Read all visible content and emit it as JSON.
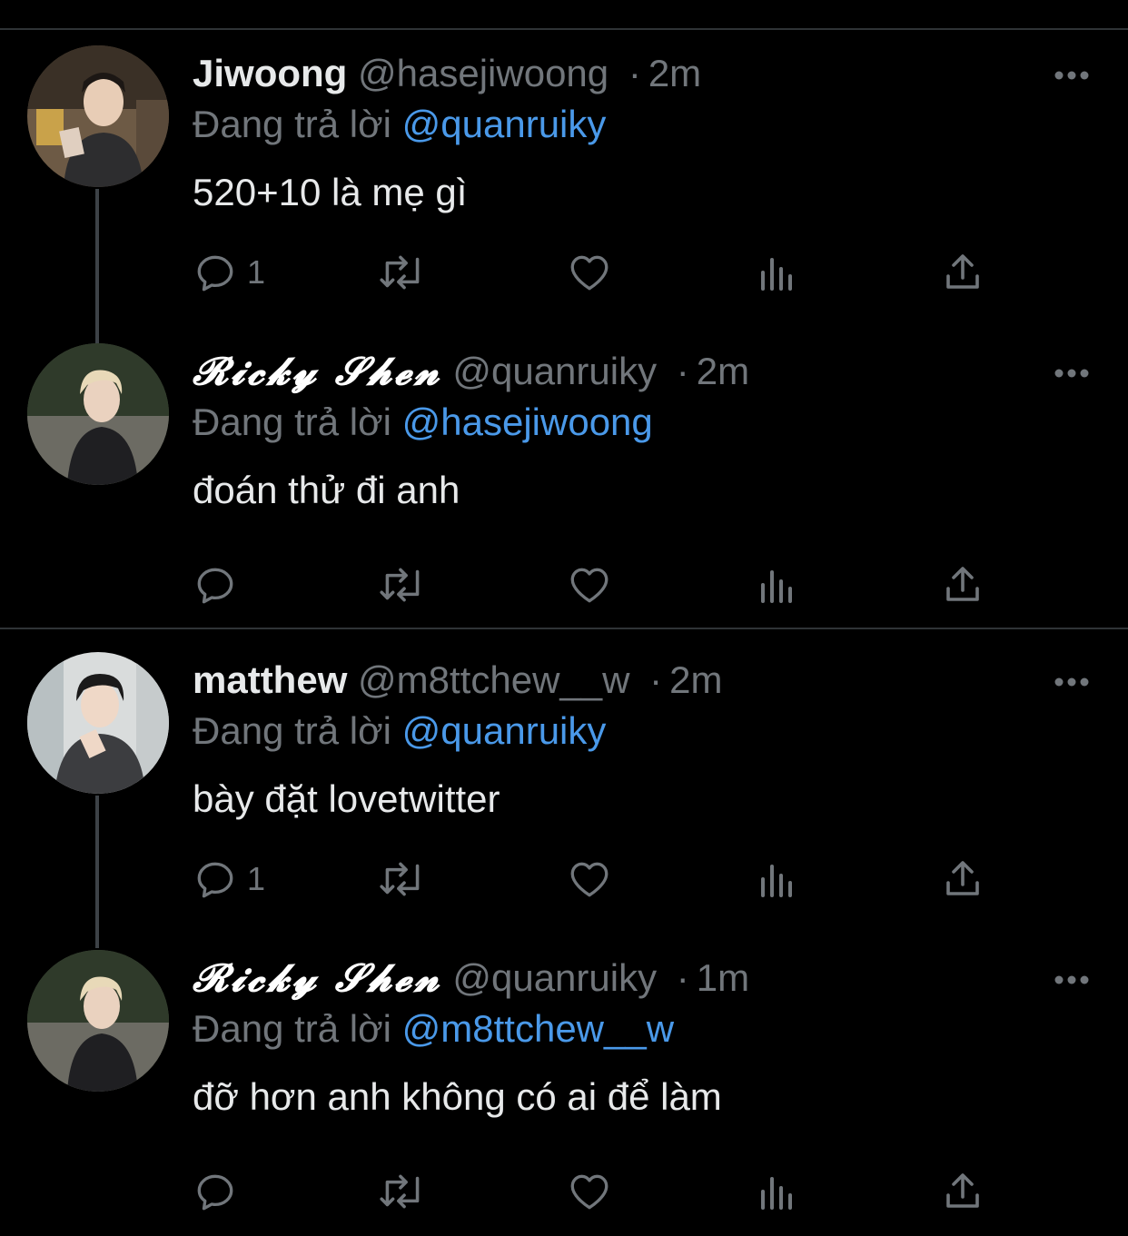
{
  "colors": {
    "background": "#000000",
    "text": "#e7e9ea",
    "muted": "#71767b",
    "link": "#4a99e9",
    "divider": "#2f3336",
    "thread_line": "#3d4247"
  },
  "reply_prefix": "Đang trả lời",
  "tweets": [
    {
      "name": "Jiwoong",
      "handle": "@hasejiwoong",
      "separator": "·",
      "time": "2m",
      "reply_to": "@quanruiky",
      "text": "520+10 là mẹ gì",
      "reply_count": "1",
      "avatar": "avatar-jiwoong"
    },
    {
      "name": "𝓡𝓲𝓬𝓴𝔂 𝓢𝓱𝓮𝓷",
      "handle": "@quanruiky",
      "separator": "·",
      "time": "2m",
      "reply_to": "@hasejiwoong",
      "text": "đoán thử đi anh",
      "reply_count": "",
      "avatar": "avatar-ricky"
    },
    {
      "name": "matthew",
      "handle": "@m8ttchew__w",
      "separator": "·",
      "time": "2m",
      "reply_to": "@quanruiky",
      "text": "bày đặt lovetwitter",
      "reply_count": "1",
      "avatar": "avatar-matthew"
    },
    {
      "name": "𝓡𝓲𝓬𝓴𝔂 𝓢𝓱𝓮𝓷",
      "handle": "@quanruiky",
      "separator": "·",
      "time": "1m",
      "reply_to": "@m8ttchew__w",
      "text": "đỡ hơn anh không có ai để làm",
      "reply_count": "",
      "avatar": "avatar-ricky"
    }
  ],
  "icons": {
    "reply": "reply-icon",
    "retweet": "retweet-icon",
    "like": "heart-icon",
    "views": "views-icon",
    "share": "share-icon",
    "more": "more-icon"
  }
}
